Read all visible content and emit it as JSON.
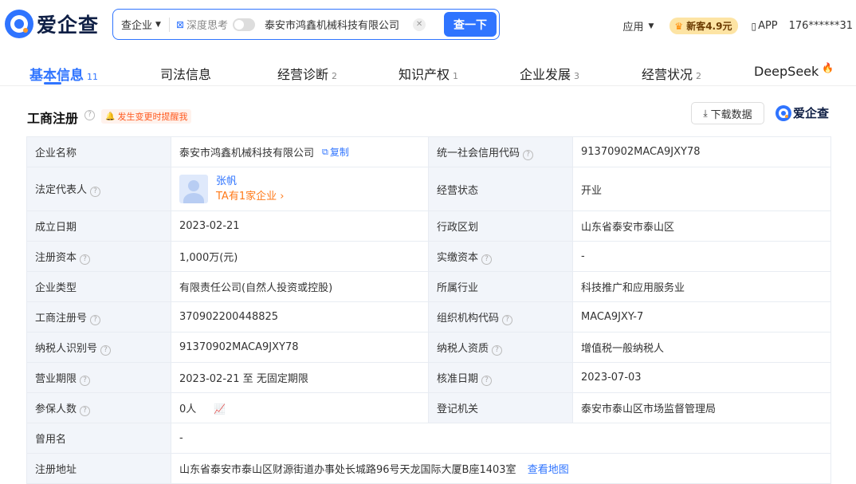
{
  "header": {
    "logo_text": "爱企查",
    "search_type": "查企业",
    "deep_think_label": "深度思考",
    "search_value": "泰安市鸿鑫机械科技有限公司",
    "search_button": "查一下",
    "apps_label": "应用",
    "vip_label": "新客4.9元",
    "app_label": "APP",
    "user_phone": "176******31"
  },
  "tabs": [
    {
      "label": "基本信息",
      "count": "11"
    },
    {
      "label": "司法信息",
      "count": ""
    },
    {
      "label": "经营诊断",
      "count": "2"
    },
    {
      "label": "知识产权",
      "count": "1"
    },
    {
      "label": "企业发展",
      "count": "3"
    },
    {
      "label": "经营状况",
      "count": "2"
    },
    {
      "label": "DeepSeek",
      "count": ""
    }
  ],
  "section": {
    "title": "工商注册",
    "notify": "发生变更时提醒我",
    "download": "下载数据",
    "brand": "爱企查"
  },
  "rows": [
    {
      "k1": "企业名称",
      "v1": "泰安市鸿鑫机械科技有限公司",
      "copy": "复制",
      "k2": "统一社会信用代码",
      "v2": "91370902MACA9JXY78"
    },
    {
      "k1": "法定代表人",
      "person_name": "张帆",
      "person_sub": "TA有1家企业 ›",
      "k2": "经营状态",
      "v2": "开业"
    },
    {
      "k1": "成立日期",
      "v1": "2023-02-21",
      "k2": "行政区划",
      "v2": "山东省泰安市泰山区"
    },
    {
      "k1": "注册资本",
      "v1": "1,000万(元)",
      "k2": "实缴资本",
      "v2": "-"
    },
    {
      "k1": "企业类型",
      "v1": "有限责任公司(自然人投资或控股)",
      "k2": "所属行业",
      "v2": "科技推广和应用服务业"
    },
    {
      "k1": "工商注册号",
      "v1": "370902200448825",
      "k2": "组织机构代码",
      "v2": "MACA9JXY-7"
    },
    {
      "k1": "纳税人识别号",
      "v1": "91370902MACA9JXY78",
      "k2": "纳税人资质",
      "v2": "增值税一般纳税人"
    },
    {
      "k1": "营业期限",
      "v1": "2023-02-21 至 无固定期限",
      "k2": "核准日期",
      "v2": "2023-07-03"
    },
    {
      "k1": "参保人数",
      "v1": "0人",
      "k2": "登记机关",
      "v2": "泰安市泰山区市场监督管理局"
    },
    {
      "k1": "曾用名",
      "v1": "-"
    },
    {
      "k1": "注册地址",
      "v1": "山东省泰安市泰山区财源街道办事处长城路96号天龙国际大厦B座1403室",
      "map": "查看地图"
    }
  ]
}
